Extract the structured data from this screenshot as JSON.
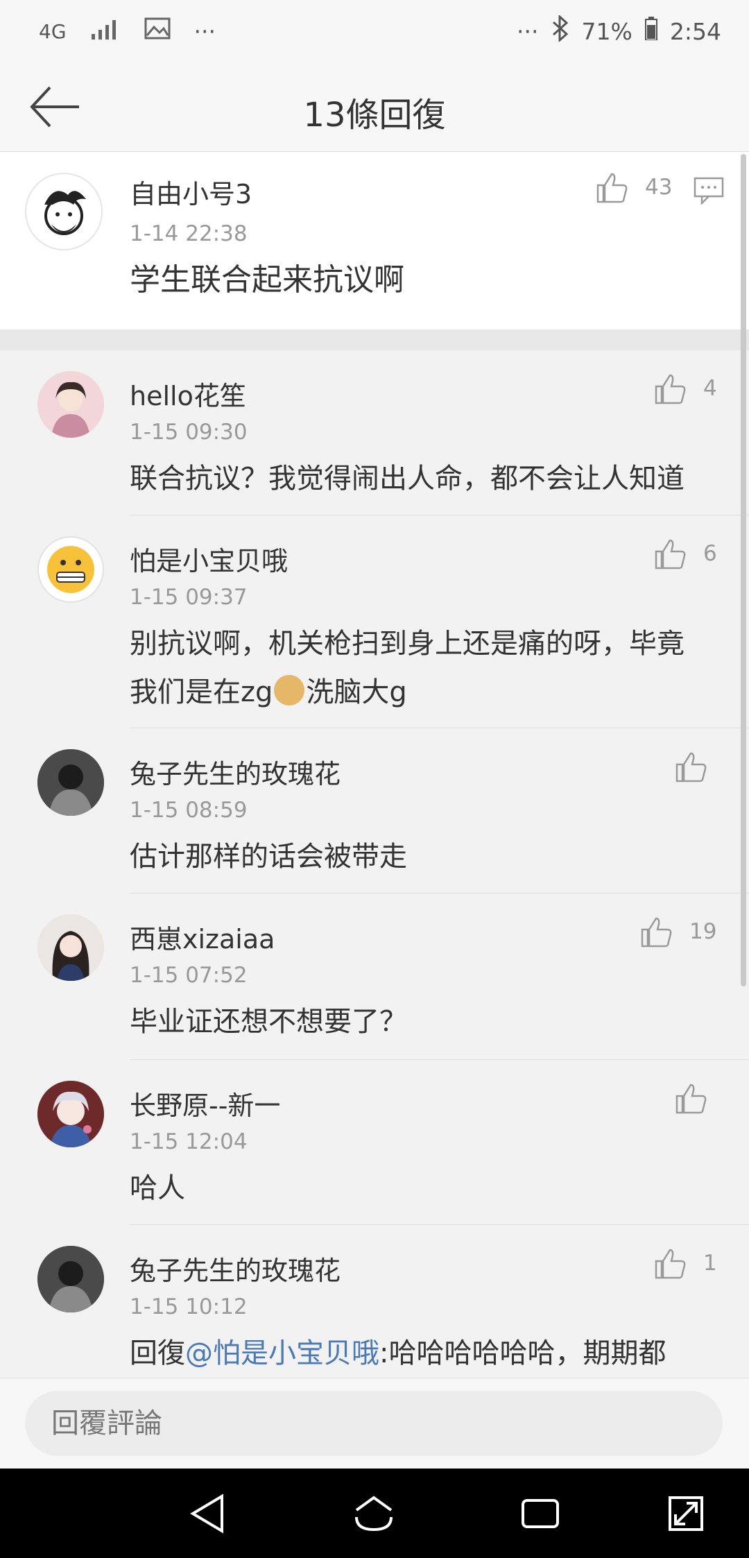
{
  "status_bar": {
    "network": "4G",
    "more": "···",
    "battery": "71%",
    "time": "2:54"
  },
  "header": {
    "title": "13條回復"
  },
  "main_comment": {
    "username": "自由小号3",
    "time": "1-14 22:38",
    "text": "学生联合起来抗议啊",
    "likes": "43"
  },
  "replies": [
    {
      "username": "hello花笙",
      "time": "1-15 09:30",
      "line1": "联合抗议？我觉得闹出人命，都不会让人知道",
      "likes": "4"
    },
    {
      "username": "怕是小宝贝哦",
      "time": "1-15 09:37",
      "line1": "别抗议啊，机关枪扫到身上还是痛的呀，毕竟",
      "line2a": "我们是在zg",
      "line2b": "洗脑大g",
      "likes": "6"
    },
    {
      "username": "兔子先生的玫瑰花",
      "time": "1-15 08:59",
      "line1": "估计那样的话会被带走",
      "likes": ""
    },
    {
      "username": "西崽xizaiaa",
      "time": "1-15 07:52",
      "line1": "毕业证还想不想要了？",
      "likes": "19"
    },
    {
      "username": "长野原--新一",
      "time": "1-15 12:04",
      "line1": "哈人",
      "likes": ""
    },
    {
      "username": "兔子先生的玫瑰花",
      "time": "1-15 10:12",
      "prefix": "回復",
      "mention": "@怕是小宝贝哦",
      "suffix": ":哈哈哈哈哈哈，期期都",
      "likes": "1"
    }
  ],
  "input": {
    "placeholder": "回覆評論"
  },
  "colors": {
    "accent_link": "#4a79b5",
    "background": "#f2f2f2"
  }
}
